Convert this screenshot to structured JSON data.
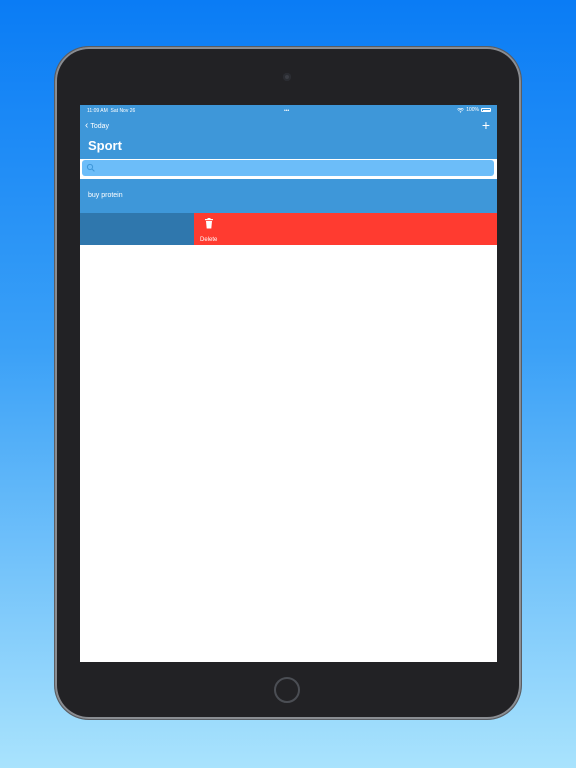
{
  "status_bar": {
    "time": "11:09 AM",
    "date": "Sat Nov 26",
    "dots": "•••",
    "battery": "100%",
    "battery_level": 1.0,
    "icons": [
      "wifi-icon",
      "battery-icon"
    ]
  },
  "nav": {
    "back_label": "Today",
    "back_icon": "chevron-left-icon",
    "add_icon": "plus-icon",
    "add_symbol": "+",
    "title": "Sport"
  },
  "search": {
    "placeholder": "",
    "value": "",
    "icon": "search-icon"
  },
  "list": {
    "items": [
      {
        "label": "buy protein"
      }
    ],
    "swipe_action": {
      "label": "Delete",
      "icon": "trash-icon"
    }
  },
  "colors": {
    "header": "#3e97d9",
    "search_bar": "#6cbdf9",
    "swiped_row": "#2f77ad",
    "delete": "#ff3b30",
    "background_top": "#0a7cf5",
    "background_bottom": "#a9e3fd"
  }
}
